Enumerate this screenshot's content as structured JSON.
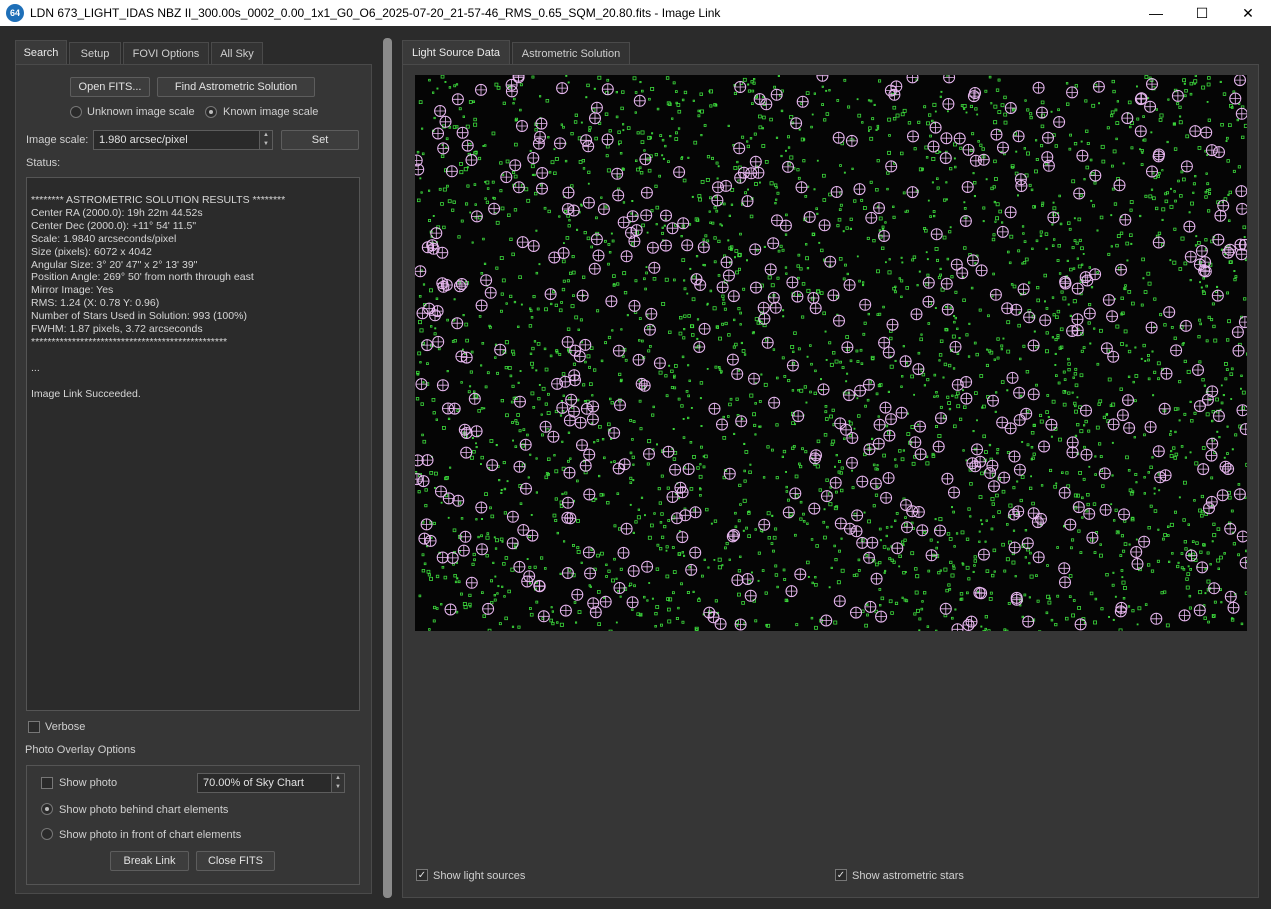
{
  "window": {
    "app_icon": "64",
    "title": "LDN 673_LIGHT_IDAS NBZ II_300.00s_0002_0.00_1x1_G0_O6_2025-07-20_21-57-46_RMS_0.65_SQM_20.80.fits - Image Link",
    "minimize": "—",
    "maximize": "☐",
    "close": "✕"
  },
  "left_tabs": [
    "Search",
    "Setup",
    "FOVI Options",
    "All Sky"
  ],
  "search": {
    "open_fits": "Open FITS...",
    "find_solution": "Find Astrometric Solution",
    "unknown_scale": "Unknown image scale",
    "known_scale": "Known image scale",
    "image_scale_label": "Image scale:",
    "image_scale_value": "1.980 arcsec/pixel",
    "set": "Set",
    "status_label": "Status:"
  },
  "status_lines": [
    "******** ASTROMETRIC SOLUTION RESULTS ********",
    "Center RA (2000.0): 19h 22m 44.52s",
    "Center Dec (2000.0): +11° 54' 11.5\"",
    "Scale: 1.9840 arcseconds/pixel",
    "Size (pixels): 6072 x 4042",
    "Angular Size: 3° 20' 47\" x 2° 13' 39\"",
    "Position Angle: 269° 50' from north through east",
    "Mirror Image: Yes",
    "RMS: 1.24 (X: 0.78 Y: 0.96)",
    "Number of Stars Used in Solution: 993 (100%)",
    "FWHM: 1.87 pixels, 3.72 arcseconds",
    "************************************************",
    "",
    "...",
    "",
    "Image Link Succeeded."
  ],
  "verbose": "Verbose",
  "overlay": {
    "title": "Photo Overlay Options",
    "show_photo": "Show photo",
    "opacity": "70.00% of Sky Chart",
    "behind": "Show photo behind chart elements",
    "front": "Show photo in front of chart elements",
    "break_link": "Break Link",
    "close_fits": "Close FITS"
  },
  "right_tabs": [
    "Light Source Data",
    "Astrometric Solution"
  ],
  "bottom": {
    "show_light": "Show light sources",
    "show_astro": "Show astrometric stars",
    "check_mark": "✓"
  },
  "colors": {
    "light_source": "#3ddc3d",
    "astrometric_star": "#e8b8f0"
  }
}
